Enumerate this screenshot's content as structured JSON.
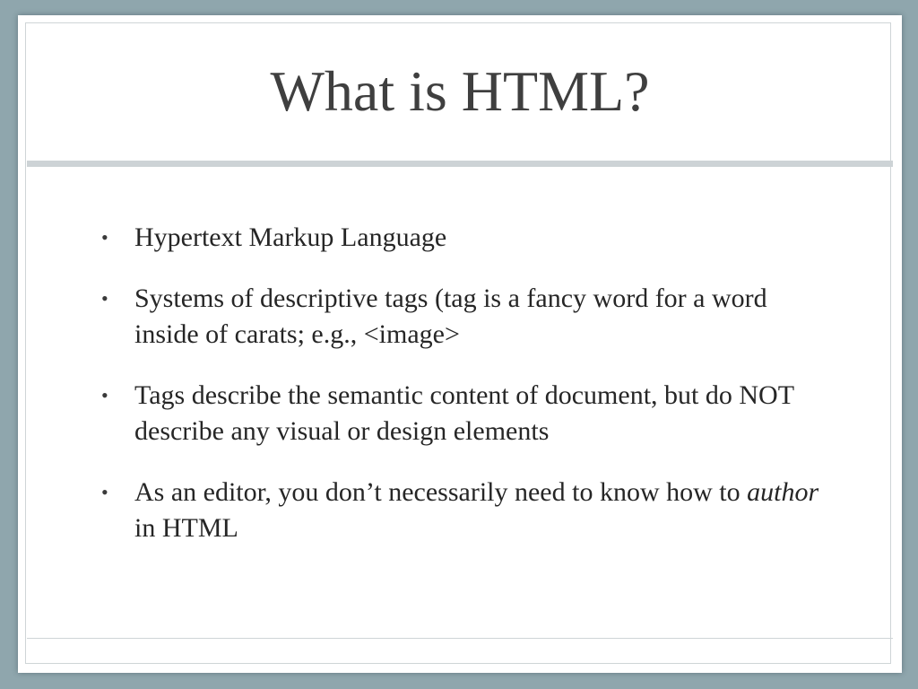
{
  "slide": {
    "title": "What is HTML?",
    "bullets": [
      {
        "text": "Hypertext Markup Language"
      },
      {
        "text": "Systems of descriptive tags (tag is a fancy word for a word inside of carats; e.g., <image>"
      },
      {
        "text": "Tags describe the semantic content of document, but do NOT describe any visual or design elements"
      },
      {
        "before": "As an editor, you don’t necessarily need to know how to ",
        "emphasis": "author",
        "after": " in HTML"
      }
    ]
  },
  "colors": {
    "background": "#8fa6ad",
    "slide": "#ffffff",
    "title_text": "#3f3f3f",
    "body_text": "#262626",
    "divider": "#cdd3d6"
  }
}
